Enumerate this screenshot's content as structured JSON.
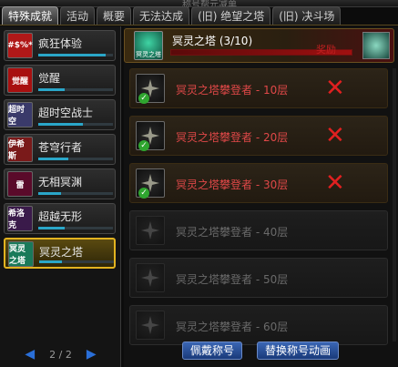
{
  "window": {
    "caption": "称号帮元减单"
  },
  "tabs": [
    {
      "label": "特殊成就",
      "active": true
    },
    {
      "label": "活动"
    },
    {
      "label": "概要"
    },
    {
      "label": "无法达成"
    },
    {
      "label": "(旧) 绝望之塔"
    },
    {
      "label": "(旧) 决斗场"
    }
  ],
  "categories": [
    {
      "label": "疯狂体验",
      "icon_text": "#$%*",
      "icon_color": "#b01818",
      "progress": 0.9
    },
    {
      "label": "觉醒",
      "icon_text": "觉醒",
      "icon_color": "#a81010",
      "progress": 0.35
    },
    {
      "label": "超时空战士",
      "icon_text": "超时空",
      "icon_color": "#3a3a6a",
      "progress": 0.6
    },
    {
      "label": "苍穹行者",
      "icon_text": "伊希斯",
      "icon_color": "#7a1a1a",
      "progress": 0.4
    },
    {
      "label": "无相冥渊",
      "icon_text": "雷",
      "icon_color": "#5a0a2a",
      "progress": 0.3
    },
    {
      "label": "超越无形",
      "icon_text": "希洛克",
      "icon_color": "#3a1a4a",
      "progress": 0.35
    },
    {
      "label": "冥灵之塔",
      "icon_text": "冥灵之塔",
      "icon_color": "#1a7a5a",
      "progress": 0.3,
      "active": true
    }
  ],
  "pager": {
    "current": "2",
    "total": "2",
    "text": "2 / 2"
  },
  "achievement": {
    "title": "冥灵之塔 (3/10)",
    "icon_text": "冥灵之塔",
    "stamp": "奖励"
  },
  "items": [
    {
      "name": "冥灵之塔攀登者 - 10层",
      "completed": true,
      "mark": "✕"
    },
    {
      "name": "冥灵之塔攀登者 - 20层",
      "completed": true,
      "mark": "✕"
    },
    {
      "name": "冥灵之塔攀登者 - 30层",
      "completed": true,
      "mark": "✕"
    },
    {
      "name": "冥灵之塔攀登者 - 40层",
      "completed": false
    },
    {
      "name": "冥灵之塔攀登者 - 50层",
      "completed": false
    },
    {
      "name": "冥灵之塔攀登者 - 60层",
      "completed": false
    }
  ],
  "buttons": {
    "wear": "佩戴称号",
    "animation": "替换称号动画"
  }
}
